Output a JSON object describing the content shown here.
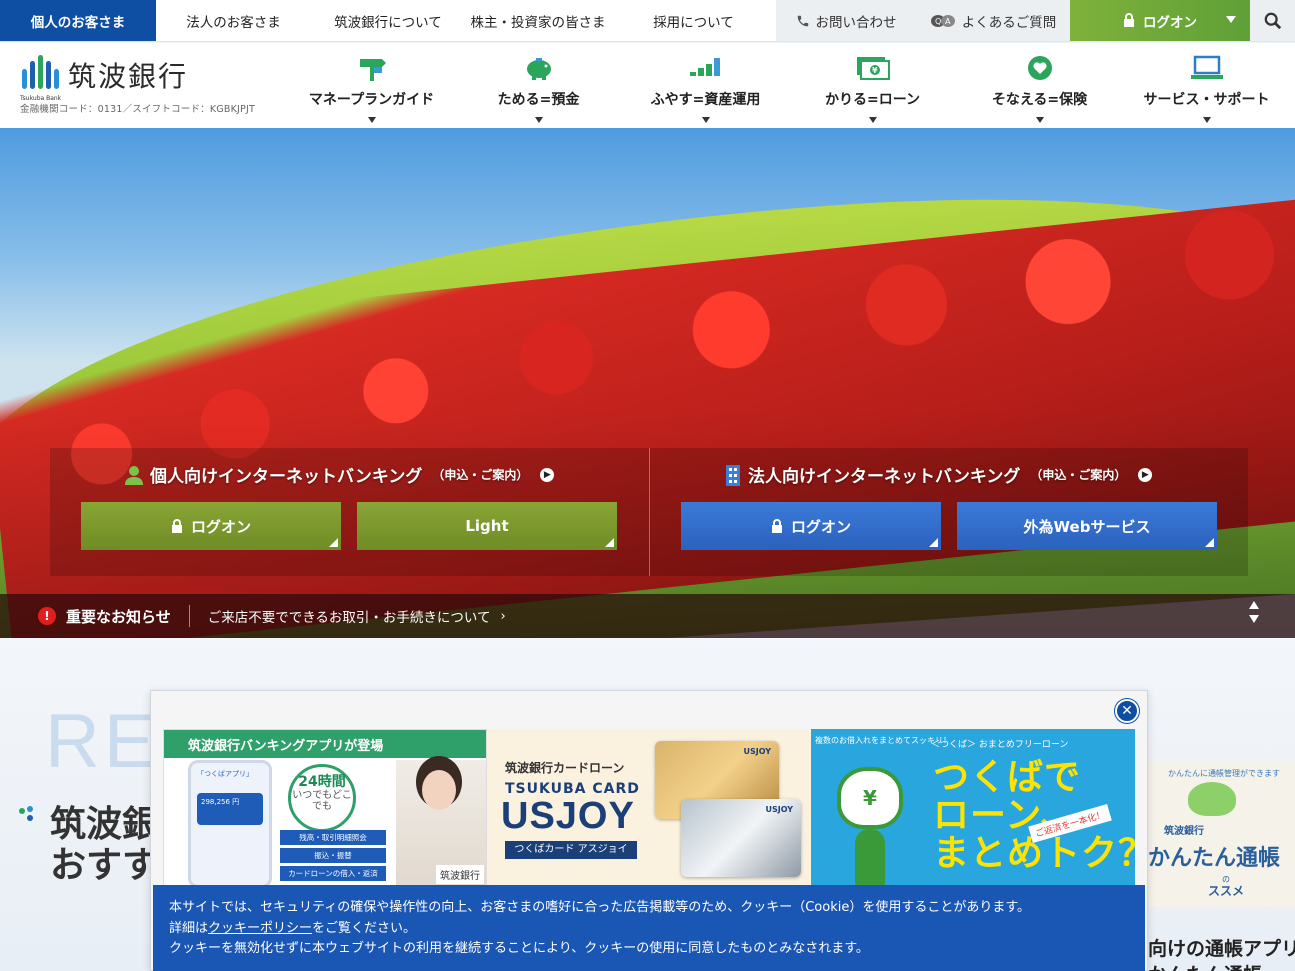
{
  "topbar": {
    "personal": "個人のお客さま",
    "corporate": "法人のお客さま",
    "about": "筑波銀行について",
    "investors": "株主・投資家の皆さま",
    "recruit": "採用について",
    "contact": "お問い合わせ",
    "faq": "よくあるご質問",
    "logon": "ログオン"
  },
  "header": {
    "logo_text": "筑波銀行",
    "logo_small": "Tsukuba Bank",
    "bank_codes": "金融機関コード：0131／スイフトコード：KGBKJPJT",
    "nav": [
      {
        "label": "マネープランガイド",
        "icon": "signpost-icon"
      },
      {
        "label": "ためる=預金",
        "icon": "piggy-bank-icon"
      },
      {
        "label": "ふやす=資産運用",
        "icon": "bar-growth-icon"
      },
      {
        "label": "かりる=ローン",
        "icon": "yen-bills-icon"
      },
      {
        "label": "そなえる=保険",
        "icon": "heart-shield-icon"
      },
      {
        "label": "サービス・サポート",
        "icon": "laptop-icon"
      }
    ]
  },
  "hero": {
    "personal_ib": {
      "title": "個人向けインターネットバンキング",
      "note": "（申込・ご案内）",
      "btn1": "ログオン",
      "btn2": "Light"
    },
    "corporate_ib": {
      "title": "法人向けインターネットバンキング",
      "note": "（申込・ご案内）",
      "btn1": "ログオン",
      "btn2": "外為Webサービス"
    }
  },
  "notice": {
    "label": "重要なお知らせ",
    "message": "ご来店不要でできるお取引・お手続きについて"
  },
  "recommend": {
    "bg_word": "RE",
    "title_line1": "筑波銀",
    "title_line2": "おすす",
    "side_top": "かんたんに通帳管理ができます",
    "side_name": "筑波銀行",
    "side_big": "かんたん通帳",
    "side_of": "の",
    "side_susume": "ススメ",
    "caption1": "向けの通帳アプリ",
    "caption2": "かんたん通帳"
  },
  "modal": {
    "banner_app": {
      "title": "筑波銀行バンキングアプリが登場",
      "phone_title": "「つくばアプリ」",
      "phone_card": "298,256 円",
      "hours": "24時間",
      "hours_sub": "いつでもどこでも",
      "menu": [
        "残高・取引明細照会",
        "振込・振替",
        "カードローンの借入・返済"
      ],
      "tag": "筑波銀行"
    },
    "banner_usjoy": {
      "l1": "筑波銀行カードローン",
      "l2": "TSUKUBA CARD",
      "l3": "USJOY",
      "l4": "つくばカード アスジョイ",
      "card_label": "USJOY"
    },
    "banner_loan": {
      "circle_text": "複数のお借入れをまとめてスッキリ！",
      "t1": "＜つくば＞ おまとめフリーローン",
      "t2a": "つくばで",
      "t2b": "ローン、",
      "t2c": "まとめトク？",
      "badge": "ご返済を一本化！",
      "yen": "¥"
    },
    "cookie": {
      "line1": "本サイトでは、セキュリティの確保や操作性の向上、お客さまの嗜好に合った広告掲載等のため、クッキー（Cookie）を使用することがあります。",
      "line2_pre": "詳細は",
      "line2_link": "クッキーポリシー",
      "line2_post": "をご覧ください。",
      "line3": "クッキーを無効化せずに本ウェブサイトの利用を継続することにより、クッキーの使用に同意したものとみなされます。"
    }
  },
  "colors": {
    "brand_blue": "#0e4fa3",
    "logon_green": "#78ad39",
    "ib_green": "#7f9a2f",
    "ib_blue": "#2f6fc9",
    "notice_red": "#e21f1f"
  }
}
